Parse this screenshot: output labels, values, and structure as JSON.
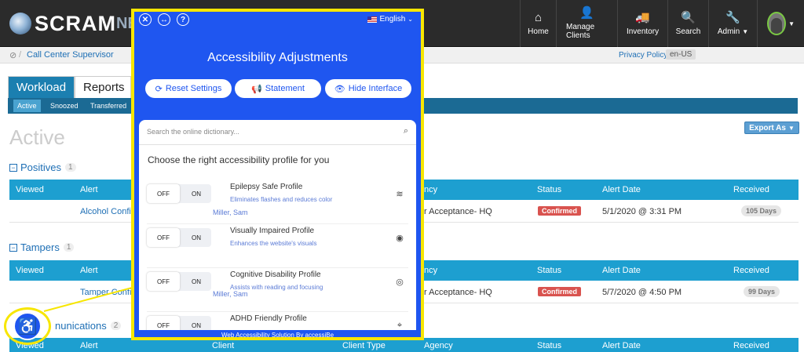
{
  "header": {
    "brand": "SCRAM",
    "brand_tail": "NE",
    "nav": [
      {
        "label": "Home",
        "icon": "home-icon",
        "glyph": "⌂"
      },
      {
        "label": "Manage Clients",
        "icon": "user-icon",
        "glyph": "👤"
      },
      {
        "label": "Inventory",
        "icon": "truck-icon",
        "glyph": "🚚"
      },
      {
        "label": "Search",
        "icon": "search-icon",
        "glyph": "🔍"
      },
      {
        "label": "Admin",
        "icon": "wrench-icon",
        "glyph": "🔧"
      }
    ]
  },
  "breadcrumb": {
    "label": "Call Center Supervisor",
    "privacy": "Privacy Policy",
    "locale": "en-US"
  },
  "tabs": {
    "workload": "Workload",
    "reports": "Reports",
    "sub": [
      "Active",
      "Snoozed",
      "Transferred"
    ]
  },
  "page": {
    "title": "Active",
    "export": "Export As"
  },
  "sections": [
    {
      "title": "Positives",
      "count": "1",
      "columns": {
        "viewed": "Viewed",
        "alert": "Alert",
        "agency": "ncy",
        "status": "Status",
        "alert_date": "Alert Date",
        "received": "Received"
      },
      "row": {
        "alert": "Alcohol Confir",
        "client": "Miller, Sam",
        "agency": "r Acceptance- HQ",
        "status": "Confirmed",
        "alert_date": "5/1/2020 @ 3:31 PM",
        "received": "105 Days"
      }
    },
    {
      "title": "Tampers",
      "count": "1",
      "columns": {
        "viewed": "Viewed",
        "alert": "Alert",
        "agency": "ncy",
        "status": "Status",
        "alert_date": "Alert Date",
        "received": "Received"
      },
      "row": {
        "alert": "Tamper Confi",
        "client": "Miller, Sam",
        "agency": "r Acceptance- HQ",
        "status": "Confirmed",
        "alert_date": "5/7/2020 @ 4:50 PM",
        "received": "99 Days"
      }
    },
    {
      "title": "nunications",
      "count": "2",
      "columns": {
        "viewed": "Viewed",
        "alert": "Alert",
        "client": "Client",
        "client_type": "Client Type",
        "agency": "Agency",
        "status": "Status",
        "alert_date": "Alert Date",
        "received": "Received"
      }
    }
  ],
  "accessibility": {
    "language": "English",
    "title": "Accessibility Adjustments",
    "buttons": {
      "reset": "Reset Settings",
      "statement": "Statement",
      "hide": "Hide Interface"
    },
    "search_placeholder": "Search the online dictionary...",
    "heading": "Choose the right accessibility profile for you",
    "toggle_off": "OFF",
    "toggle_on": "ON",
    "profiles": [
      {
        "name": "Epilepsy Safe Profile",
        "desc": "Eliminates flashes and reduces color",
        "icon": "epilepsy-icon"
      },
      {
        "name": "Visually Impaired Profile",
        "desc": "Enhances the website's visuals",
        "icon": "eye-icon"
      },
      {
        "name": "Cognitive Disability Profile",
        "desc": "Assists with reading and focusing",
        "icon": "brain-icon"
      },
      {
        "name": "ADHD Friendly Profile",
        "desc": "",
        "icon": "target-icon"
      }
    ],
    "footer": "Web Accessibility Solution By accessiBe"
  }
}
